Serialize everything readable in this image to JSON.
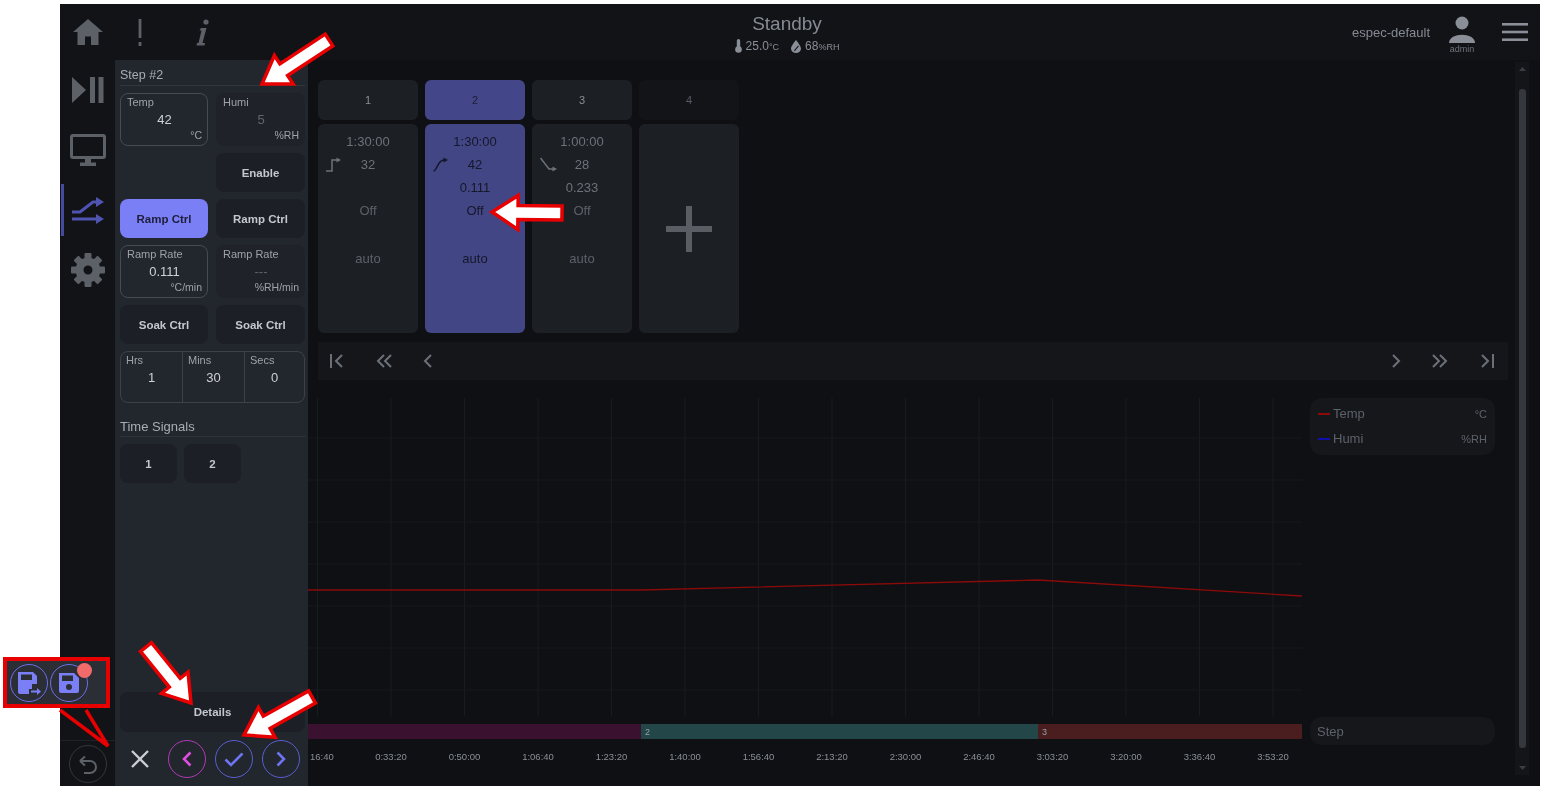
{
  "header": {
    "status": "Standby",
    "temperature": {
      "value": "25.0",
      "unit": "°C"
    },
    "humidity": {
      "value": "68",
      "unit": "%RH"
    },
    "profile": "espec-default",
    "user": "admin"
  },
  "nav": [
    {
      "kind": "run",
      "selected": false
    },
    {
      "kind": "monitor",
      "selected": false
    },
    {
      "kind": "program",
      "selected": true
    },
    {
      "kind": "settings",
      "selected": false
    }
  ],
  "step_editor": {
    "title": "Step #2",
    "setpoints": [
      {
        "label": "Temp",
        "value": "42",
        "unit": "°C",
        "enabled": true
      },
      {
        "label": "Humi",
        "value": "5",
        "unit": "%RH",
        "enabled": false
      }
    ],
    "enable_button": "Enable",
    "ramp_ctrl": [
      {
        "label": "Ramp Ctrl",
        "selected": true
      },
      {
        "label": "Ramp Ctrl",
        "selected": false
      }
    ],
    "ramp_rates": [
      {
        "label": "Ramp Rate",
        "value": "0.111",
        "unit": "°C/min",
        "enabled": true
      },
      {
        "label": "Ramp Rate",
        "value": "---",
        "unit": "%RH/min",
        "enabled": false
      }
    ],
    "soak_ctrl": [
      {
        "label": "Soak Ctrl",
        "selected": false
      },
      {
        "label": "Soak Ctrl",
        "selected": false
      }
    ],
    "duration": [
      {
        "label": "Hrs",
        "value": "1"
      },
      {
        "label": "Mins",
        "value": "30"
      },
      {
        "label": "Secs",
        "value": "0"
      }
    ],
    "time_signals": {
      "title": "Time Signals",
      "buttons": [
        "1",
        "2"
      ]
    },
    "details_button": "Details"
  },
  "steps": [
    {
      "number": "1",
      "selected": false,
      "duration": "1:30:00",
      "kind": "jump",
      "setpoint": "32",
      "soak": "Off",
      "mode": "auto"
    },
    {
      "number": "2",
      "selected": true,
      "duration": "1:30:00",
      "kind": "rise",
      "setpoint": "42",
      "rate": "0.111",
      "soak": "Off",
      "mode": "auto"
    },
    {
      "number": "3",
      "selected": false,
      "duration": "1:00:00",
      "kind": "fall",
      "setpoint": "28",
      "rate": "0.233",
      "soak": "Off",
      "mode": "auto"
    }
  ],
  "new_step": {
    "number": "4"
  },
  "chart": {
    "legend": [
      {
        "label": "Temp",
        "unit": "°C",
        "color": "#8b0a0a"
      },
      {
        "label": "Humi",
        "unit": "%RH",
        "color": "#1010a8"
      }
    ],
    "step_label": "Step"
  },
  "timeline": {
    "segments": [
      {
        "color": "#3a1230"
      },
      {
        "label": "2",
        "color": "#234649"
      },
      {
        "label": "3",
        "color": "#4a1d1e"
      }
    ],
    "ticks": [
      "16:40",
      "0:33:20",
      "0:50:00",
      "1:06:40",
      "1:23:20",
      "1:40:00",
      "1:56:40",
      "2:13:20",
      "2:30:00",
      "2:46:40",
      "3:03:20",
      "3:20:00",
      "3:36:40",
      "3:53:20"
    ]
  },
  "save_callout": {
    "unsaved": true
  }
}
